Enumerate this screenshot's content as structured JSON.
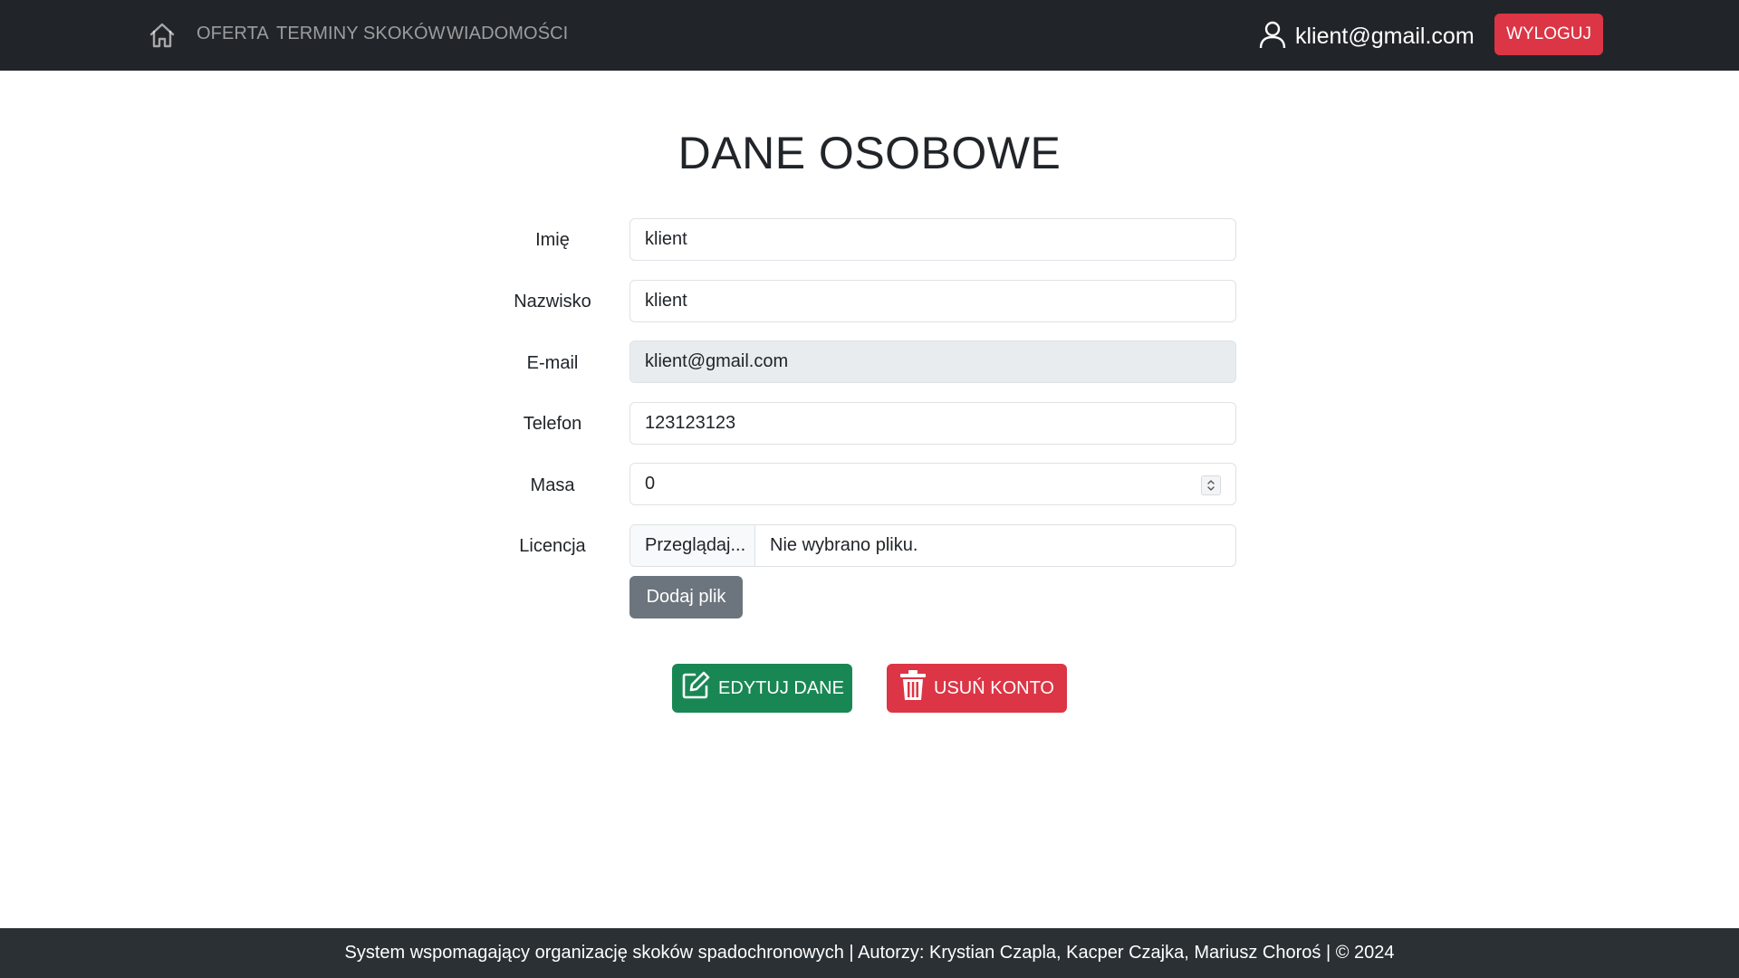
{
  "navbar": {
    "home_icon": "house-icon",
    "links": [
      "OFERTA",
      "TERMINY SKOKÓW",
      "WIADOMOŚCI"
    ],
    "user_icon": "person-icon",
    "user_email": "klient@gmail.com",
    "logout_label": "WYLOGUJ"
  },
  "page": {
    "title": "DANE OSOBOWE"
  },
  "form": {
    "first_name": {
      "label": "Imię",
      "value": "klient"
    },
    "last_name": {
      "label": "Nazwisko",
      "value": "klient"
    },
    "email": {
      "label": "E-mail",
      "value": "klient@gmail.com"
    },
    "phone": {
      "label": "Telefon",
      "value": "123123123"
    },
    "weight": {
      "label": "Masa",
      "value": "0"
    },
    "license": {
      "label": "Licencja",
      "browse_label": "Przeglądaj...",
      "file_status": "Nie wybrano pliku."
    },
    "add_file_label": "Dodaj plik"
  },
  "actions": {
    "edit_label": "EDYTUJ DANE",
    "edit_icon": "pencil-square-icon",
    "delete_label": "USUŃ KONTO",
    "delete_icon": "trash-icon"
  },
  "colors": {
    "navbar_bg": "#212529",
    "danger": "#dc3545",
    "success": "#198754",
    "secondary": "#6c757d",
    "footer_bg": "#2b3035"
  },
  "footer": {
    "text": "System wspomagający organizację skoków spadochronowych | Autorzy: Krystian Czapla, Kacper Czajka, Mariusz Choroś | © 2024"
  }
}
